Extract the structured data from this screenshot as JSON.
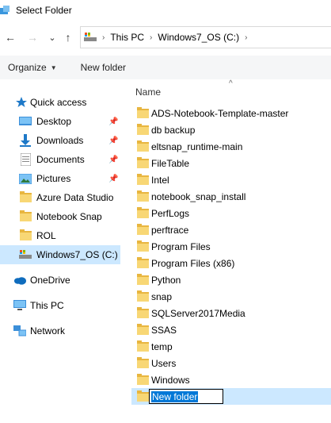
{
  "window": {
    "title": "Select Folder"
  },
  "nav": {
    "back": "←",
    "forward": "→",
    "recent": "⌄",
    "up": "↑"
  },
  "address": {
    "crumbs": [
      "This PC",
      "Windows7_OS (C:)"
    ],
    "separator": "›"
  },
  "toolbar": {
    "organize_label": "Organize",
    "new_folder_label": "New folder"
  },
  "sidebar": {
    "items": [
      {
        "label": "Quick access",
        "icon": "star-icon",
        "pinned": false
      },
      {
        "label": "Desktop",
        "icon": "desktop-icon",
        "pinned": true
      },
      {
        "label": "Downloads",
        "icon": "downloads-icon",
        "pinned": true
      },
      {
        "label": "Documents",
        "icon": "documents-icon",
        "pinned": true
      },
      {
        "label": "Pictures",
        "icon": "pictures-icon",
        "pinned": true
      },
      {
        "label": "Azure Data Studio",
        "icon": "folder-icon",
        "pinned": false
      },
      {
        "label": "Notebook Snap",
        "icon": "folder-icon",
        "pinned": false
      },
      {
        "label": "ROL",
        "icon": "folder-icon",
        "pinned": false
      },
      {
        "label": "Windows7_OS (C:)",
        "icon": "drive-icon",
        "pinned": false,
        "selected": true
      },
      {
        "label": "OneDrive",
        "icon": "cloud-icon",
        "pinned": false
      },
      {
        "label": "This PC",
        "icon": "computer-icon",
        "pinned": false
      },
      {
        "label": "Network",
        "icon": "network-icon",
        "pinned": false
      }
    ]
  },
  "content": {
    "column_header": "Name",
    "folders": [
      "ADS-Notebook-Template-master",
      "db backup",
      "eltsnap_runtime-main",
      "FileTable",
      "Intel",
      "notebook_snap_install",
      "PerfLogs",
      "perftrace",
      "Program Files",
      "Program Files (x86)",
      "Python",
      "snap",
      "SQLServer2017Media",
      "SSAS",
      "temp",
      "Users",
      "Windows"
    ],
    "new_folder_value": "New folder"
  },
  "colors": {
    "selection": "#cce8ff",
    "text_selection": "#0078d7",
    "folder": "#f8d775"
  }
}
